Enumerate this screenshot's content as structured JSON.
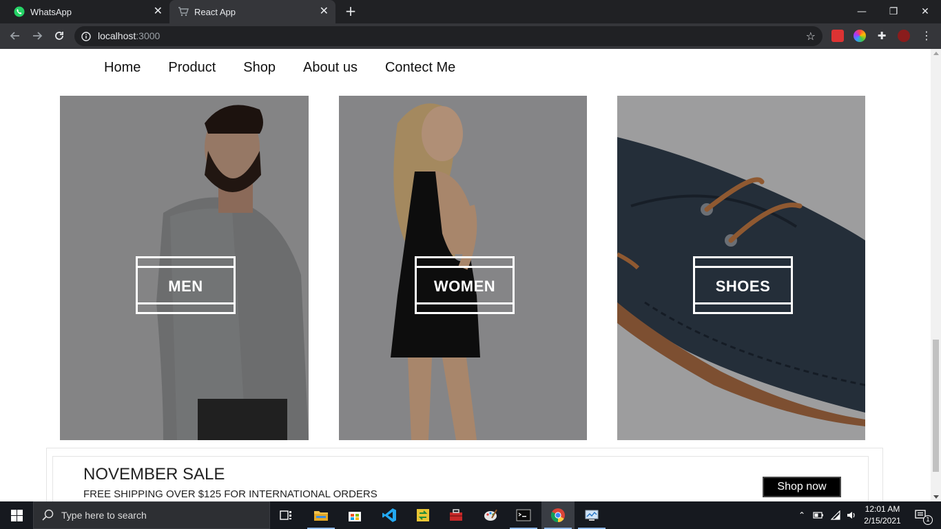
{
  "browser": {
    "tabs": [
      {
        "title": "WhatsApp",
        "icon": "whatsapp-icon"
      },
      {
        "title": "React App",
        "icon": "cart-icon"
      }
    ],
    "url_host": "localhost",
    "url_port": ":3000"
  },
  "page": {
    "nav": [
      "Home",
      "Product",
      "Shop",
      "About us",
      "Contect Me"
    ],
    "categories": [
      {
        "label": "MEN",
        "image": "man-in-grey-sweater"
      },
      {
        "label": "WOMEN",
        "image": "woman-in-black-dress"
      },
      {
        "label": "SHOES",
        "image": "navy-loafer-shoe"
      }
    ],
    "sale": {
      "title": "NOVEMBER SALE",
      "subtitle": "FREE SHIPPING OVER $125 FOR INTERNATIONAL ORDERS",
      "button": "Shop now"
    }
  },
  "taskbar": {
    "search_placeholder": "Type here to search",
    "time": "12:01 AM",
    "date": "2/15/2021",
    "notification_count": "1"
  },
  "colors": {
    "tab_strip": "#202124",
    "toolbar": "#35363a",
    "taskbar": "#16191f",
    "button_bg": "#000000"
  }
}
